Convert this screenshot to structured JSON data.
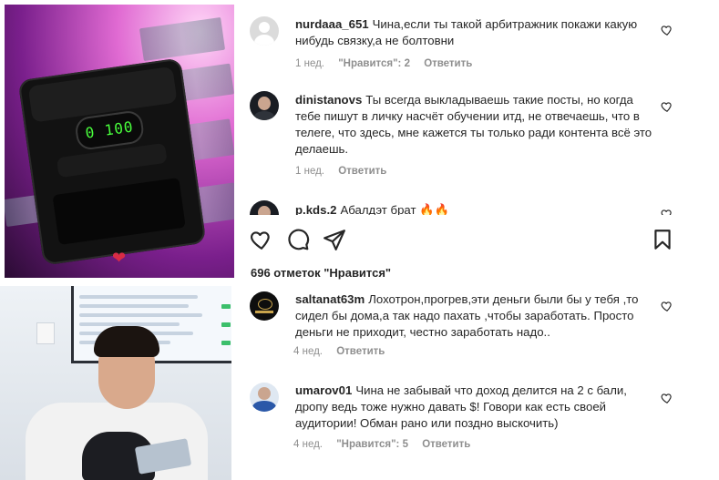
{
  "top_image": {
    "counter_display": "0 100"
  },
  "top_comments": [
    {
      "username": "nurdaaa_651",
      "text": "Чина,если ты такой арбитражник покажи какую нибудь связку,а не болтовни",
      "time": "1 нед.",
      "likes": "\"Нравится\": 2",
      "reply": "Ответить"
    },
    {
      "username": "dinistanovs",
      "text": "Ты всегда выкладываешь такие посты, но когда тебе пишут в личку насчёт обучении итд, не отвечаешь, что в телеге, что здесь, мне кажется ты только ради контента всё это делаешь.",
      "time": "1 нед.",
      "reply": "Ответить"
    },
    {
      "username": "p.kds.2",
      "text": "Абалдэт брат 🔥🔥"
    }
  ],
  "actions": {
    "likes_count": "696 отметок \"Нравится\""
  },
  "bottom_comments": [
    {
      "username": "saltanat63m",
      "text": "Лохотрон,прогрев,эти деньги были бы у тебя ,то сидел бы дома,а так надо пахать ,чтобы заработать. Просто деньги не приходит, честно заработать надо..",
      "time": "4 нед.",
      "reply": "Ответить"
    },
    {
      "username": "umarov01",
      "text": "Чина не забывай что доход делится на 2 с бали, дропу ведь тоже нужно давать $! Говори как есть своей аудитории! Обман рано или поздно выскочить)",
      "time": "4 нед.",
      "likes": "\"Нравится\": 5",
      "reply": "Ответить"
    }
  ],
  "colors": {
    "text": "#262626",
    "meta": "#8e8e8e",
    "counter_green": "#49ff3c"
  },
  "icons": [
    "heart-icon",
    "comment-icon",
    "share-icon",
    "bookmark-icon",
    "like-comment-icon",
    "heart-emoji-icon"
  ]
}
